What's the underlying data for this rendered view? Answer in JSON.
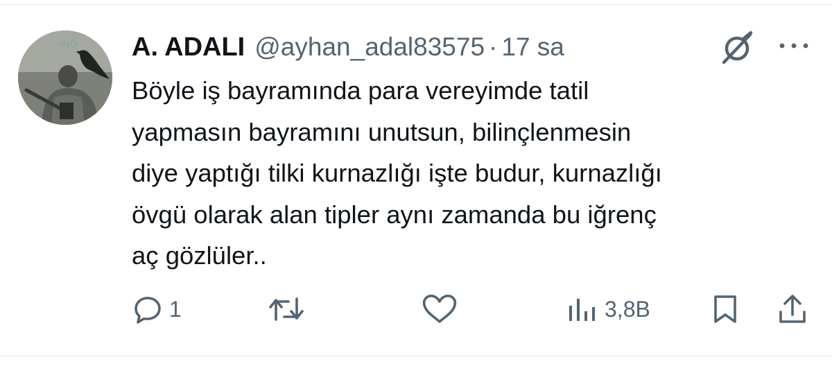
{
  "tweet": {
    "display_name": "A. ADALI",
    "handle": "@ayhan_adal83575",
    "separator": "·",
    "time": "17 sa",
    "text": "Böyle iş bayramında para vereyimde tatil\nyapmasın bayramını unutsun, bilinçlenmesin\ndiye yaptığı tilki kurnazlığı işte budur, kurnazlığı\növgü olarak alan tipler aynı zamanda bu iğrenç\naç gözlüler.."
  },
  "header_icons": {
    "grok": "grok-icon",
    "more": "more-icon"
  },
  "actions": {
    "reply": {
      "icon": "reply-icon",
      "count": "1"
    },
    "repost": {
      "icon": "repost-icon",
      "count": ""
    },
    "like": {
      "icon": "heart-icon",
      "count": ""
    },
    "views": {
      "icon": "views-icon",
      "count": "3,8B"
    },
    "bookmark": {
      "icon": "bookmark-icon"
    },
    "share": {
      "icon": "share-icon"
    }
  },
  "colors": {
    "text": "#0f1419",
    "secondary": "#536471",
    "divider": "#e6e9ec"
  }
}
